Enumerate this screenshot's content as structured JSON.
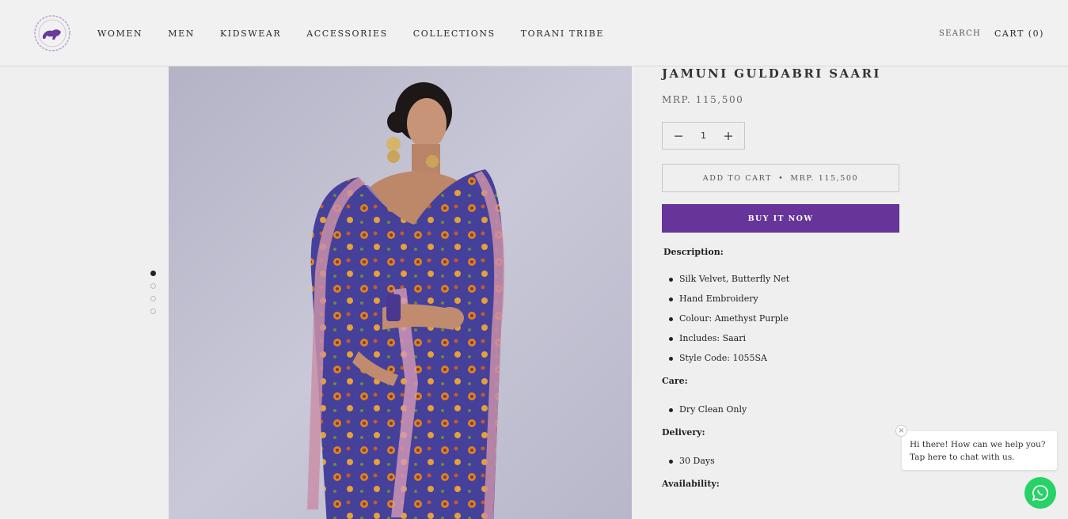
{
  "header": {
    "nav": [
      "WOMEN",
      "MEN",
      "KIDSWEAR",
      "ACCESSORIES",
      "COLLECTIONS",
      "TORANI TRIBE"
    ],
    "search_label": "SEARCH",
    "cart_label": "CART (0)"
  },
  "gallery": {
    "slide_count": 4,
    "active_index": 0
  },
  "product": {
    "title": "JAMUNI GULDABRI SAARI",
    "price": "MRP. 115,500",
    "quantity": "1",
    "add_to_cart_label": "ADD TO CART",
    "add_to_cart_separator": "•",
    "add_to_cart_price": "MRP. 115,500",
    "buy_now_label": "BUY IT NOW"
  },
  "description": {
    "description_heading": "Description:",
    "description_items": [
      "Silk Velvet, Butterfly Net",
      "Hand Embroidery",
      "Colour: Amethyst Purple",
      "Includes: Saari",
      "Style Code: 1055SA"
    ],
    "care_heading": "Care:",
    "care_items": [
      "Dry Clean Only"
    ],
    "delivery_heading": "Delivery:",
    "delivery_items": [
      "30 Days"
    ],
    "availability_heading": "Availability:"
  },
  "chat": {
    "close_glyph": "×",
    "line1": "Hi there! How can we help you?",
    "line2": "Tap here to chat with us."
  },
  "colors": {
    "accent": "#673499",
    "whatsapp": "#25d366",
    "background": "#efefef"
  },
  "icons": [
    "torani-logo-icon",
    "minus-icon",
    "plus-icon",
    "whatsapp-icon",
    "close-icon"
  ]
}
